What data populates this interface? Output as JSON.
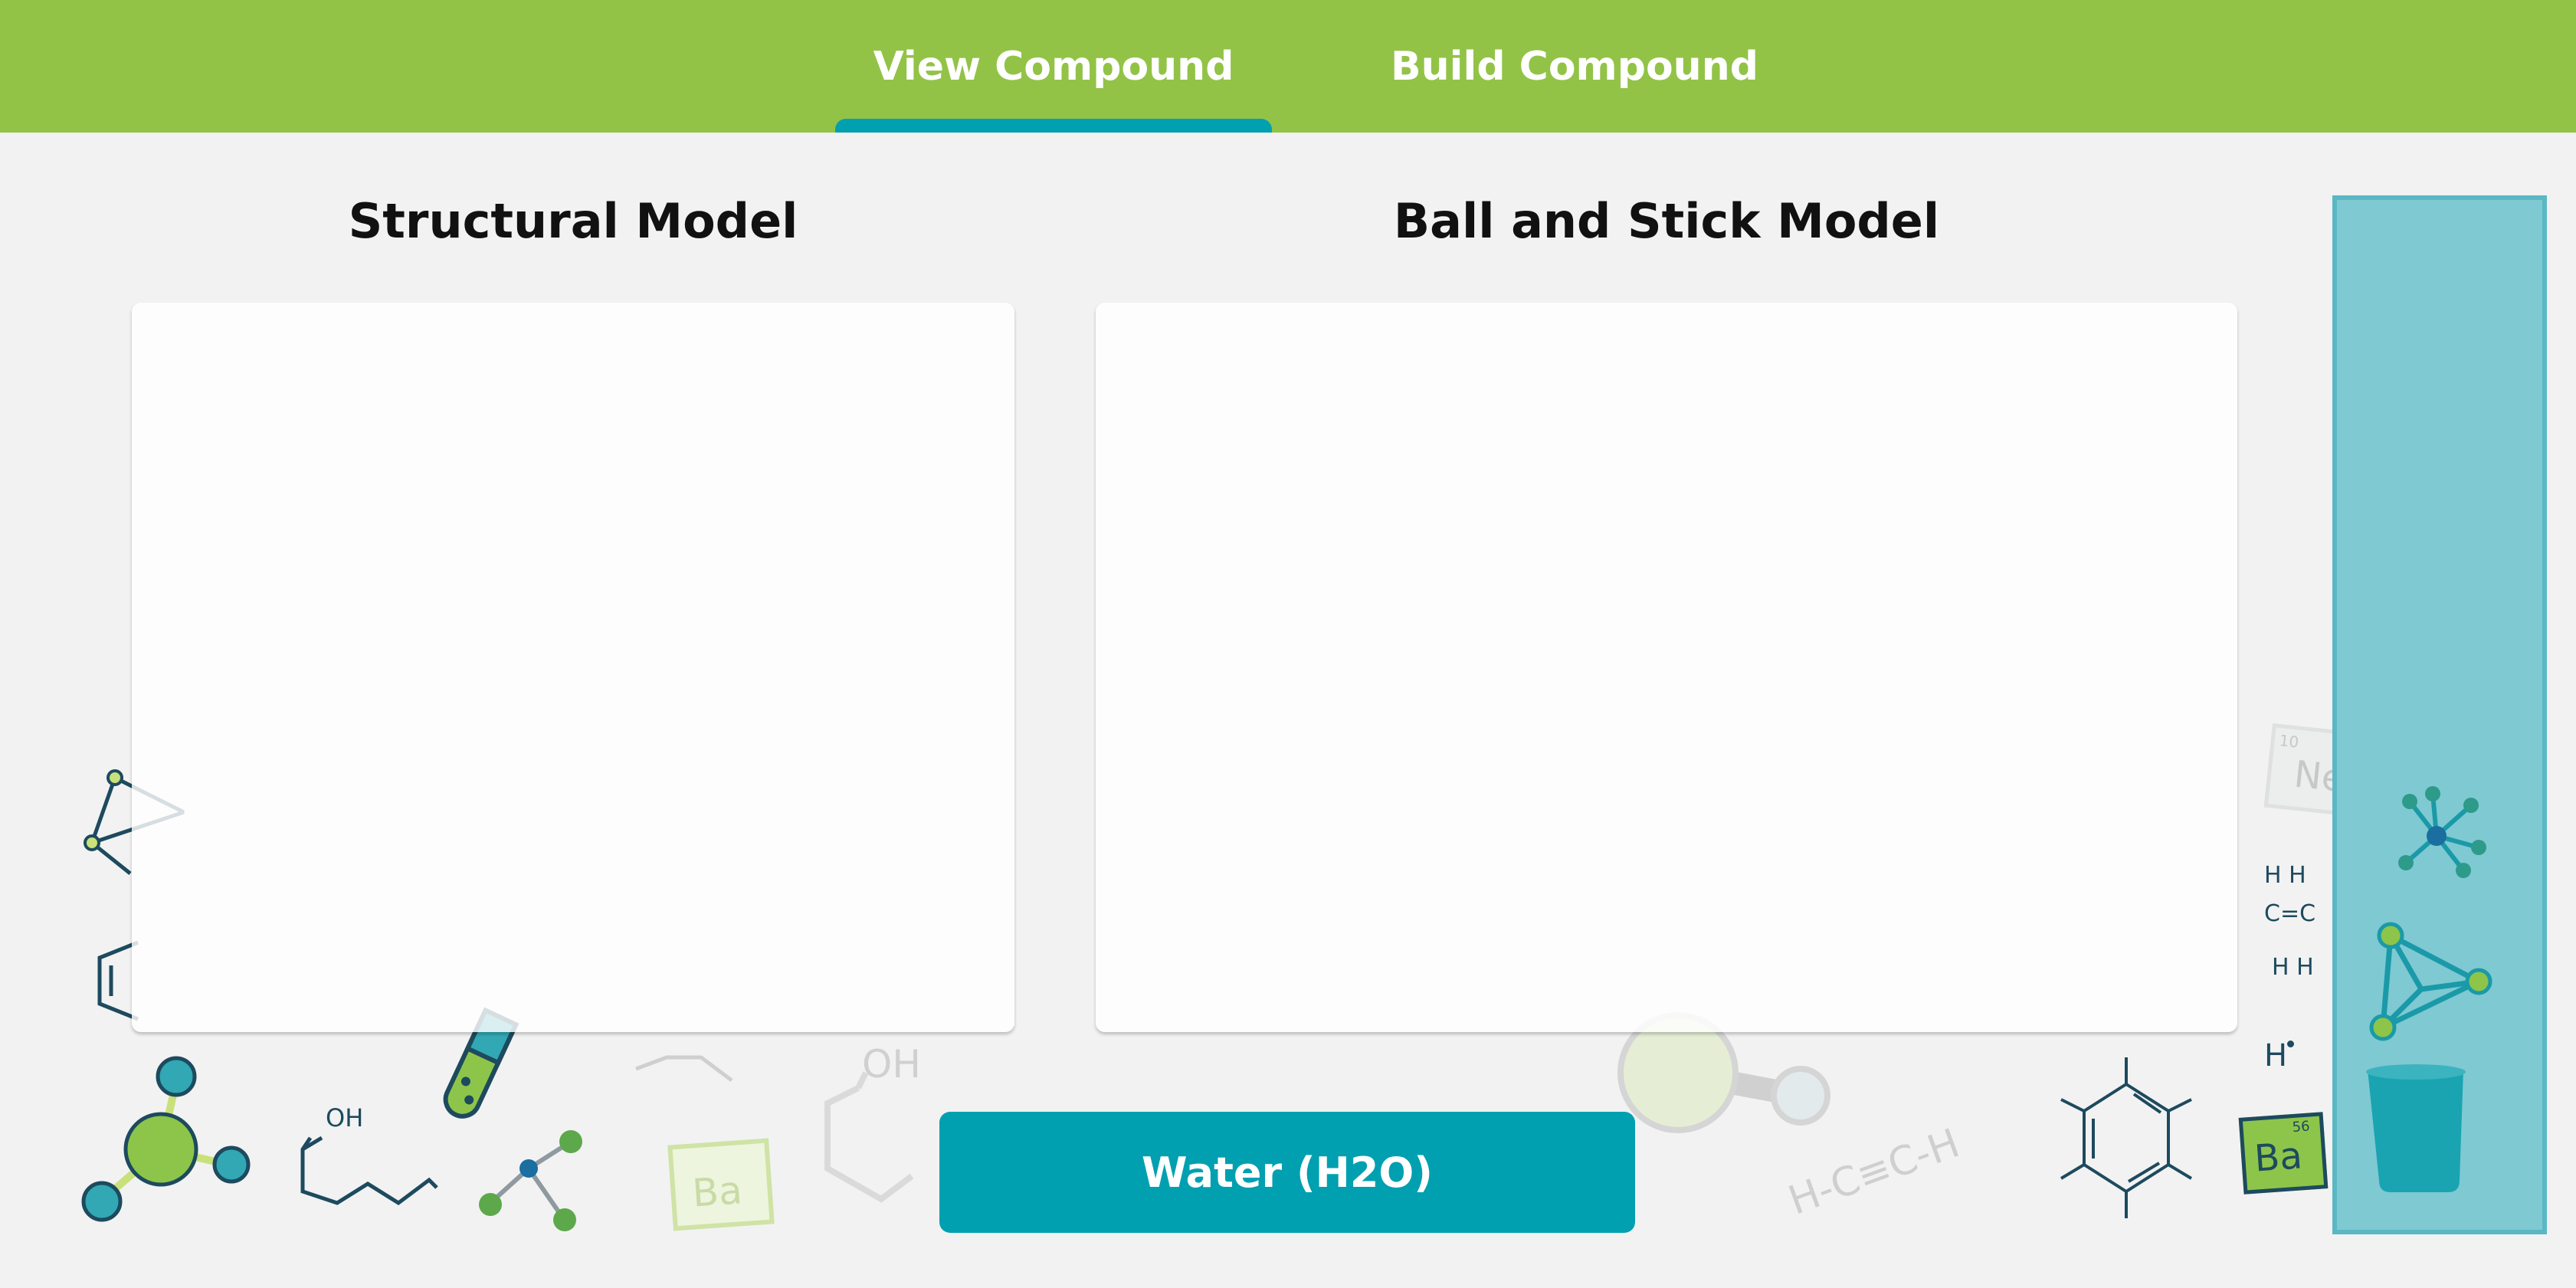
{
  "tabs": [
    {
      "label": "View Compound",
      "active": true
    },
    {
      "label": "Build Compound",
      "active": false
    }
  ],
  "sections": {
    "structural_title": "Structural Model",
    "ballstick_title": "Ball and Stick Model"
  },
  "compound_button": {
    "label": "Water (H2O)"
  },
  "sidebar": {
    "items": [
      {
        "icon": "molecule-star-icon"
      },
      {
        "icon": "tetrahedron-molecule-icon"
      },
      {
        "icon": "beaker-icon"
      }
    ]
  },
  "decor": {
    "h_radical": "H",
    "ba_symbol": "Ba",
    "ba_number": "56",
    "ne_symbol": "Ne",
    "ne_number": "10",
    "oh_label": "OH",
    "alkyne": "H-C≡C-H",
    "ethene_top": "H H",
    "ethene_mid": "C=C",
    "ethene_bot": "H H"
  },
  "colors": {
    "topbar": "#92c347",
    "accent": "#00a0b0",
    "sidebar": "#7fc9d2",
    "background": "#f2f2f2"
  }
}
